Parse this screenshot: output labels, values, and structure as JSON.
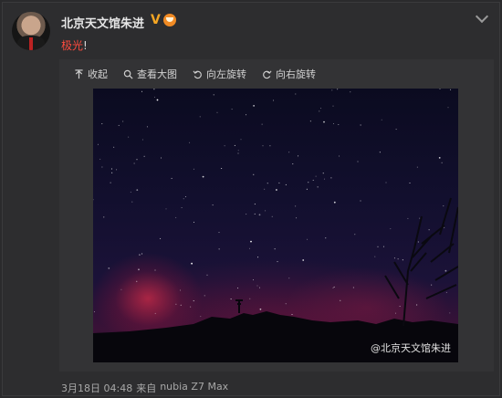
{
  "post": {
    "username": "北京天文馆朱进",
    "verified_mark": "V",
    "text_highlight": "极光",
    "text_suffix": "!",
    "timestamp": "3月18日 04:48",
    "source_prefix": "来自",
    "device": "nubia Z7 Max"
  },
  "media_toolbar": {
    "collapse_label": "收起",
    "view_large_label": "查看大图",
    "rotate_left_label": "向左旋转",
    "rotate_right_label": "向右旋转"
  },
  "photo": {
    "watermark": "@北京天文馆朱进"
  },
  "colors": {
    "highlight_red": "#ff4b3e",
    "verified_orange": "#f5a623",
    "background": "#2d2d2f"
  }
}
